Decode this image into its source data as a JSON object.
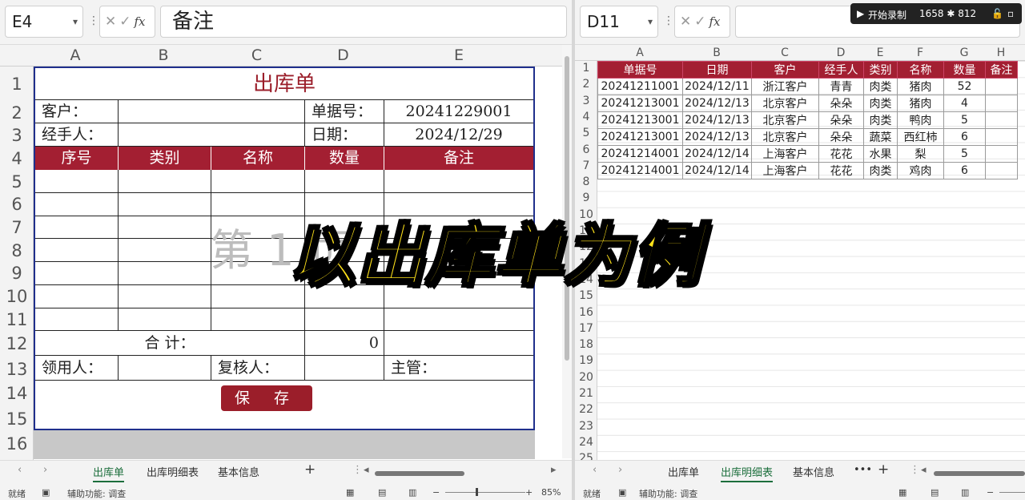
{
  "left": {
    "namebox": "E4",
    "fx": "fx",
    "formula": "备注",
    "columns": [
      "A",
      "B",
      "C",
      "D",
      "E"
    ],
    "rows": [
      "1",
      "2",
      "3",
      "4",
      "5",
      "6",
      "7",
      "8",
      "9",
      "10",
      "11",
      "12",
      "13",
      "14",
      "15",
      "16"
    ],
    "form": {
      "title": "出库单",
      "customer_label": "客户：",
      "docno_label": "单据号：",
      "docno_value": "20241229001",
      "handler_label": "经手人：",
      "date_label": "日期：",
      "date_value": "2024/12/29",
      "headers": [
        "序号",
        "类别",
        "名称",
        "数量",
        "备注"
      ],
      "total_label": "合  计：",
      "total_value": "0",
      "receiver_label": "领用人：",
      "reviewer_label": "复核人：",
      "supervisor_label": "主管：",
      "save_label": "保 存",
      "watermark": "第 1 页"
    },
    "tabs": [
      "出库单",
      "出库明细表",
      "基本信息"
    ],
    "status_ready": "就绪",
    "status_access": "辅助功能: 调查",
    "zoom": "85%"
  },
  "right": {
    "namebox": "D11",
    "fx": "fx",
    "columns": [
      "A",
      "B",
      "C",
      "D",
      "E",
      "F",
      "G",
      "H"
    ],
    "rows": [
      "1",
      "2",
      "3",
      "4",
      "5",
      "6",
      "7",
      "8",
      "9",
      "10",
      "11",
      "12",
      "13",
      "14",
      "15",
      "16",
      "17",
      "18",
      "19",
      "20",
      "21",
      "22",
      "23",
      "24",
      "25"
    ],
    "table_headers": [
      "单据号",
      "日期",
      "客户",
      "经手人",
      "类别",
      "名称",
      "数量",
      "备注"
    ],
    "table_rows": [
      [
        "20241211001",
        "2024/12/11",
        "浙江客户",
        "青青",
        "肉类",
        "猪肉",
        "52",
        ""
      ],
      [
        "20241213001",
        "2024/12/13",
        "北京客户",
        "朵朵",
        "肉类",
        "猪肉",
        "4",
        ""
      ],
      [
        "20241213001",
        "2024/12/13",
        "北京客户",
        "朵朵",
        "肉类",
        "鸭肉",
        "5",
        ""
      ],
      [
        "20241213001",
        "2024/12/13",
        "北京客户",
        "朵朵",
        "蔬菜",
        "西红柿",
        "6",
        ""
      ],
      [
        "20241214001",
        "2024/12/14",
        "上海客户",
        "花花",
        "水果",
        "梨",
        "5",
        ""
      ],
      [
        "20241214001",
        "2024/12/14",
        "上海客户",
        "花花",
        "肉类",
        "鸡肉",
        "6",
        ""
      ]
    ],
    "tabs": [
      "出库单",
      "出库明细表",
      "基本信息"
    ],
    "status_ready": "就绪",
    "status_access": "辅助功能: 调查"
  },
  "recorder": {
    "label": "开始录制",
    "size": "1658 ✱ 812"
  },
  "banner": "以出库单为例"
}
